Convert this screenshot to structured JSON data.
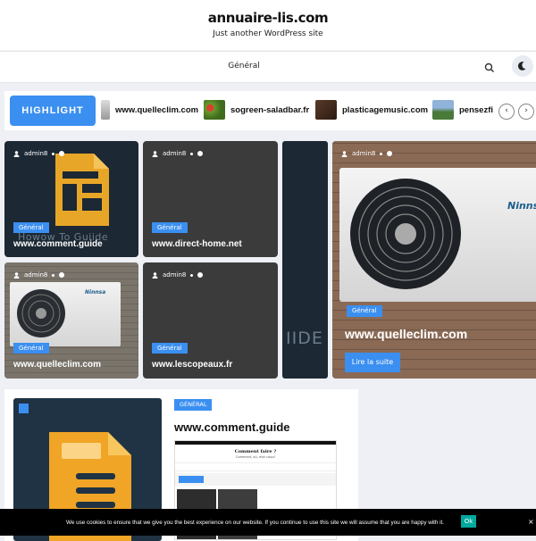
{
  "header": {
    "site_title": "annuaire-lis.com",
    "site_description": "Just another WordPress site"
  },
  "nav": {
    "item_general": "Général"
  },
  "highlight": {
    "badge": "HIGHLIGHT",
    "items": [
      "www.quelleclim.com",
      "sogreen-saladbar.fr",
      "plasticagemusic.com",
      "pensezfi"
    ],
    "prev": "‹",
    "next": "›"
  },
  "meta": {
    "author": "admin8"
  },
  "cards": [
    {
      "category": "Général",
      "title": "www.comment.guide",
      "thumb_text": "Howow To Guiide"
    },
    {
      "category": "Général",
      "title": "www.direct-home.net"
    },
    {
      "category": "Général",
      "title": "www.quelleclim.com",
      "brand": "Ninnsa"
    },
    {
      "category": "Général",
      "title": "www.lescopeaux.fr"
    },
    {
      "category": "Général",
      "title": "www.quelleclim.com",
      "read_more": "Lire la suite",
      "brand": "Ninns"
    }
  ],
  "peek_text": "IIDE",
  "post": {
    "category": "GÉNÉRAL",
    "title": "www.comment.guide",
    "shot_title": "Comment faire ?",
    "shot_sub": "Comment, où, mot coup!"
  },
  "cookie": {
    "text": "We use cookies to ensure that we give you the best experience on our website. If you continue to use this site we will assume that you are happy with it.",
    "ok": "Ok",
    "close": "×"
  },
  "colors": {
    "accent": "#3b8ff0",
    "cookie_ok": "#00a99d"
  }
}
